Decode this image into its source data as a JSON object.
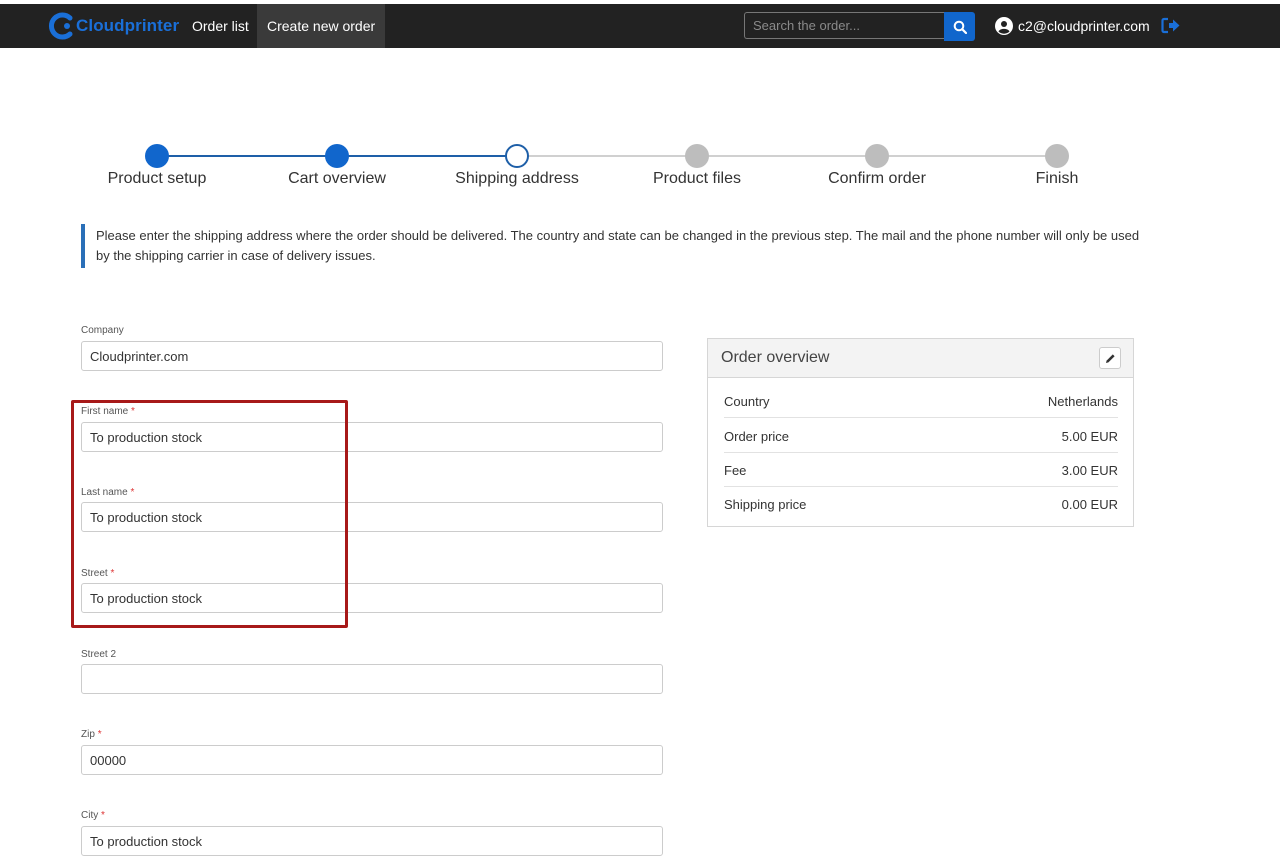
{
  "navbar": {
    "brand": "Cloudprinter",
    "links": [
      "Order list",
      "Create new order"
    ],
    "search_placeholder": "Search the order...",
    "user_email": "c2@cloudprinter.com"
  },
  "stepper": {
    "steps": [
      {
        "label": "Product setup",
        "state": "done"
      },
      {
        "label": "Cart overview",
        "state": "done"
      },
      {
        "label": "Shipping address",
        "state": "current"
      },
      {
        "label": "Product files",
        "state": "todo"
      },
      {
        "label": "Confirm order",
        "state": "todo"
      },
      {
        "label": "Finish",
        "state": "todo"
      }
    ]
  },
  "info_text": "Please enter the shipping address where the order should be delivered. The country and state can be changed in the previous step. The mail and the phone number will only be used by the shipping carrier in case of delivery issues.",
  "form": {
    "required_mark": "*",
    "fields": [
      {
        "label": "Company",
        "required": false,
        "value": "Cloudprinter.com"
      },
      {
        "label": "First name",
        "required": true,
        "value": "To production stock"
      },
      {
        "label": "Last name",
        "required": true,
        "value": "To production stock"
      },
      {
        "label": "Street",
        "required": true,
        "value": "To production stock"
      },
      {
        "label": "Street 2",
        "required": false,
        "value": ""
      },
      {
        "label": "Zip",
        "required": true,
        "value": "00000"
      },
      {
        "label": "City",
        "required": true,
        "value": "To production stock"
      }
    ]
  },
  "order_overview": {
    "title": "Order overview",
    "rows": [
      {
        "key": "Country",
        "value": "Netherlands"
      },
      {
        "key": "Order price",
        "value": "5.00 EUR"
      },
      {
        "key": "Fee",
        "value": "3.00 EUR"
      },
      {
        "key": "Shipping price",
        "value": "0.00 EUR"
      }
    ]
  },
  "colors": {
    "navbar": "#222222",
    "accent": "#1166cc",
    "highlight": "#a71919",
    "step_todo": "#bdbdbd"
  }
}
